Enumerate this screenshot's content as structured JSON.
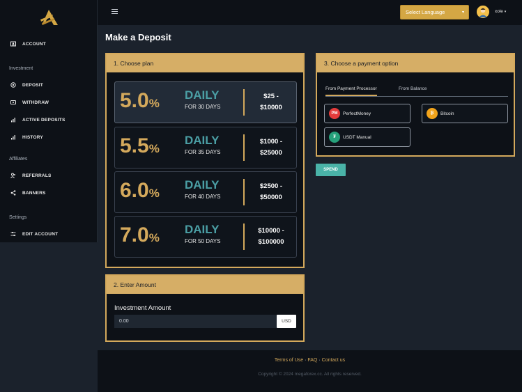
{
  "topbar": {
    "language_select": "Select Language",
    "username": "xole"
  },
  "sidebar": {
    "items_top": [
      {
        "label": "ACCOUNT",
        "icon": "account-icon"
      }
    ],
    "section_investment": "Investment",
    "items_investment": [
      {
        "label": "DEPOSIT",
        "icon": "deposit-icon"
      },
      {
        "label": "WITHDRAW",
        "icon": "withdraw-icon"
      },
      {
        "label": "ACTIVE DEPOSITS",
        "icon": "bar-chart-icon"
      },
      {
        "label": "HISTORY",
        "icon": "bar-chart-icon"
      }
    ],
    "section_affiliates": "Affiliates",
    "items_affiliates": [
      {
        "label": "REFERRALS",
        "icon": "users-icon"
      },
      {
        "label": "BANNERS",
        "icon": "share-icon"
      }
    ],
    "section_settings": "Settings",
    "items_settings": [
      {
        "label": "EDIT ACCOUNT",
        "icon": "sliders-icon"
      }
    ]
  },
  "main": {
    "page_title": "Make a Deposit",
    "choose_plan": {
      "header": "1. Choose plan",
      "plans": [
        {
          "rate": "5.0",
          "pct": "%",
          "daily": "DAILY",
          "days": "FOR 30 DAYS",
          "price_line1": "$25 -",
          "price_line2": "$10000"
        },
        {
          "rate": "5.5",
          "pct": "%",
          "daily": "DAILY",
          "days": "FOR 35 DAYS",
          "price_line1": "$1000 -",
          "price_line2": "$25000"
        },
        {
          "rate": "6.0",
          "pct": "%",
          "daily": "DAILY",
          "days": "FOR 40 DAYS",
          "price_line1": "$2500 -",
          "price_line2": "$50000"
        },
        {
          "rate": "7.0",
          "pct": "%",
          "daily": "DAILY",
          "days": "FOR 50 DAYS",
          "price_line1": "$10000 -",
          "price_line2": "$100000"
        }
      ]
    },
    "enter_amount": {
      "header": "2. Enter Amount",
      "label": "Investment Amount",
      "value": "0.00",
      "currency": "USD"
    },
    "payment": {
      "header": "3. Choose a payment option",
      "tabs": [
        "From Payment Processor",
        "From Balance"
      ],
      "options": [
        {
          "label": "PerfectMoney",
          "icon": "perfectmoney-icon",
          "icon_text": "PM",
          "color": "#e53b3b"
        },
        {
          "label": "Bitcoin",
          "icon": "bitcoin-icon",
          "icon_text": "₿",
          "color": "#f2a41b"
        },
        {
          "label": "USDT Manual",
          "icon": "tether-icon",
          "icon_text": "₮",
          "color": "#26a17b"
        }
      ]
    },
    "spend_button": "SPEND"
  },
  "footer": {
    "links": [
      "Terms of Use",
      "FAQ",
      "Contact us"
    ],
    "separator": "·",
    "copyright": "Copyright © 2024 megaforex.cc. All rights reserved."
  },
  "colors": {
    "gold": "#d4a95c",
    "teal": "#4b9fa5",
    "sidebar_bg": "#0d1117",
    "page_bg": "#1b222c"
  }
}
